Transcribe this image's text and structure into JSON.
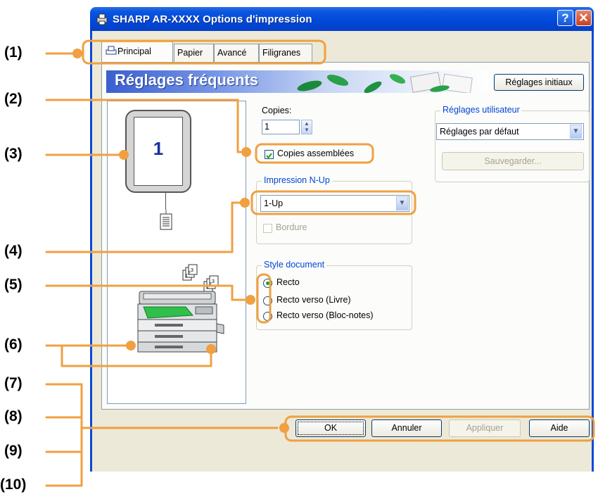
{
  "window": {
    "title": "SHARP AR-XXXX Options d'impression",
    "help_glyph": "?",
    "close_glyph": "✕"
  },
  "tabs": [
    {
      "label": "Principal",
      "selected": true
    },
    {
      "label": "Papier"
    },
    {
      "label": "Avancé"
    },
    {
      "label": "Filigranes"
    }
  ],
  "banner": {
    "title": "Réglages fréquents"
  },
  "reset_button": "Réglages initiaux",
  "preview": {
    "page_number": "1"
  },
  "copies": {
    "label": "Copies:",
    "value": "1"
  },
  "collate": {
    "label": "Copies assemblées",
    "checked": true
  },
  "nup": {
    "title": "Impression N-Up",
    "value": "1-Up",
    "border_label": "Bordure",
    "border_checked": false
  },
  "style": {
    "title": "Style document",
    "options": [
      "Recto",
      "Recto verso (Livre)",
      "Recto verso (Bloc-notes)"
    ],
    "selected": "Recto"
  },
  "user_settings": {
    "title": "Réglages utilisateur",
    "value": "Réglages par défaut",
    "save_label": "Sauvegarder..."
  },
  "footer": {
    "ok": "OK",
    "cancel": "Annuler",
    "apply": "Appliquer",
    "help": "Aide"
  },
  "callouts": [
    "(1)",
    "(2)",
    "(3)",
    "(4)",
    "(5)",
    "(6)",
    "(7)",
    "(8)",
    "(9)",
    "(10)"
  ],
  "colors": {
    "callout": "#f0a040",
    "titlebar": "#0148d8",
    "dialog_bg": "#ece9d8"
  }
}
